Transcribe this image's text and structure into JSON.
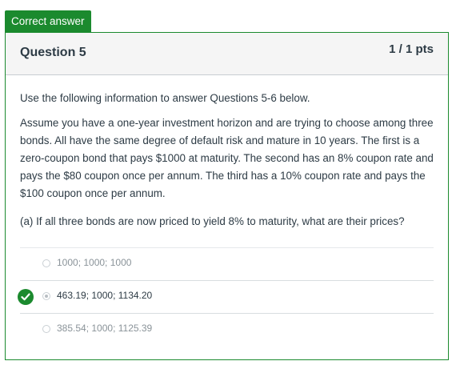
{
  "tab": {
    "label": "Correct answer"
  },
  "question": {
    "title": "Question 5",
    "points": "1 / 1 pts",
    "intro": "Use the following information to answer Questions 5-6 below.",
    "scenario": "Assume you have a one-year investment horizon and are trying to choose among three bonds. All have the same degree of default risk and mature in 10 years. The first is a zero-coupon bond that pays $1000 at maturity. The second has an 8% coupon rate and pays the $80 coupon once per annum. The third has a 10% coupon rate and pays the $100 coupon once per annum.",
    "prompt": "(a) If all three bonds are now priced to yield 8% to maturity, what are their prices?"
  },
  "answers": [
    {
      "text": "1000; 1000; 1000",
      "selected": false,
      "correct": false
    },
    {
      "text": "463.19; 1000; 1134.20",
      "selected": true,
      "correct": true
    },
    {
      "text": "385.54; 1000; 1125.39",
      "selected": false,
      "correct": false
    }
  ],
  "colors": {
    "correct_green": "#1b8a2e",
    "text": "#2d3b45",
    "muted_text": "#8a9399",
    "header_bg": "#f5f5f5"
  },
  "icons": {
    "correct_marker": "check-icon"
  }
}
